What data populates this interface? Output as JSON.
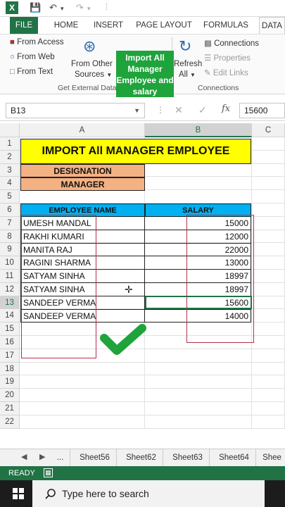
{
  "quick_access": {
    "app_icon": "excel-icon",
    "save_icon": "save-icon",
    "undo_icon": "undo-icon",
    "redo_icon": "redo-icon"
  },
  "ribbon_tabs": [
    "FILE",
    "HOME",
    "INSERT",
    "PAGE LAYOUT",
    "FORMULAS",
    "DATA"
  ],
  "ribbon": {
    "from_access": "From Access",
    "from_web": "From Web",
    "from_text": "From Text",
    "from_other_1": "From Other",
    "from_other_2": "Sources",
    "get_external_data": "Get External Data",
    "refresh_1": "Refresh",
    "refresh_2": "All",
    "connections": "Connections",
    "properties": "Properties",
    "edit_links": "Edit Links",
    "connections_group": "Connections"
  },
  "overlay_text": [
    "Import All",
    "Manager",
    "Employee and",
    "salary"
  ],
  "formula_bar": {
    "name_box": "B13",
    "value": "15600"
  },
  "columns": [
    "A",
    "B",
    "C"
  ],
  "rows": [
    "1",
    "2",
    "3",
    "4",
    "5",
    "6",
    "7",
    "8",
    "9",
    "10",
    "11",
    "12",
    "13",
    "14",
    "15",
    "16",
    "17",
    "18",
    "19",
    "20",
    "21",
    "22"
  ],
  "sheet": {
    "title": "IMPORT All MANAGER EMPLOYEE",
    "designation_label": "DESIGNATION",
    "designation_value": "MANAGER",
    "header_name": "EMPLOYEE NAME",
    "header_salary": "SALARY",
    "records": [
      {
        "name": "UMESH MANDAL",
        "salary": "15000"
      },
      {
        "name": "RAKHI KUMARI",
        "salary": "12000"
      },
      {
        "name": "MANITA RAJ",
        "salary": "22000"
      },
      {
        "name": "RAGINI SHARMA",
        "salary": "13000"
      },
      {
        "name": "SATYAM SINHA",
        "salary": "18997"
      },
      {
        "name": "SATYAM SINHA",
        "salary": "18997"
      },
      {
        "name": "SANDEEP VERMA",
        "salary": "15600"
      },
      {
        "name": "SANDEEP VERMA",
        "salary": "14000"
      }
    ]
  },
  "sheet_tabs": [
    "...",
    "Sheet56",
    "Sheet62",
    "Sheet63",
    "Sheet64",
    "Shee"
  ],
  "status": {
    "text": "READY"
  },
  "taskbar": {
    "search_placeholder": "Type here to search"
  },
  "colors": {
    "excel_green": "#217346",
    "title_yellow": "#ffff00",
    "orange": "#f4b183",
    "blue_header": "#00b0f0",
    "check_green": "#1fa33b"
  }
}
